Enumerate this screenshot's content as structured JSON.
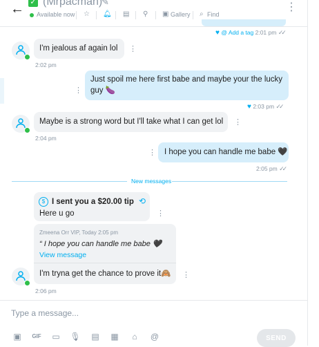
{
  "header": {
    "contact_name": "(Mrpacman)",
    "status": "Available now",
    "gallery_label": "Gallery",
    "find_label": "Find"
  },
  "messages": {
    "first_meta": {
      "tag_label": "@ Add a tag",
      "time": "2:01 pm"
    },
    "m1": {
      "text": "I'm jealous af again lol",
      "time": "2:02 pm"
    },
    "m2": {
      "text_line1": "Just spoil me here first babe and maybe your the lucky",
      "text_line2": "guy 🍆",
      "time": "2:03 pm"
    },
    "m3": {
      "text": "Maybe is a strong word but I'll take what I can get lol",
      "time": "2:04 pm"
    },
    "m4": {
      "text": "I hope you can handle me babe 🖤",
      "time": "2:05 pm"
    },
    "divider": "New messages",
    "tip": {
      "title": "I sent you a $20.00 tip",
      "body": "Here u go"
    },
    "quote": {
      "author": "Zmeena Orr VIP, Today 2:05 pm",
      "text": "“ I hope you can handle me babe 🖤",
      "view_label": "View message"
    },
    "m5": {
      "text": "I'm tryna get the chance to prove it",
      "emoji": "🙈",
      "time": "2:06 pm"
    }
  },
  "composer": {
    "placeholder": "Type a message...",
    "send_label": "SEND"
  },
  "colors": {
    "accent": "#00aff0",
    "online": "#2fbf4a",
    "incoming": "#f0f2f4",
    "outgoing": "#d6eefb",
    "muted": "#8a96a3"
  }
}
